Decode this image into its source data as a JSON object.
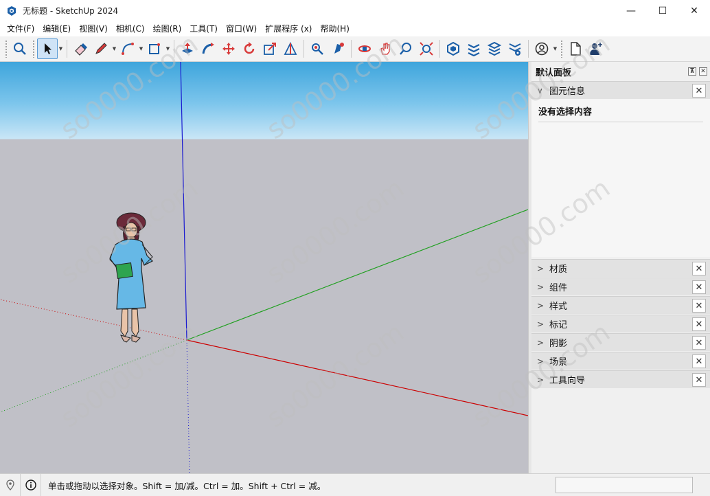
{
  "window": {
    "title": "无标题 - SketchUp 2024",
    "controls": [
      "—",
      "☐",
      "✕"
    ]
  },
  "menu": [
    "文件(F)",
    "编辑(E)",
    "视图(V)",
    "相机(C)",
    "绘图(R)",
    "工具(T)",
    "窗口(W)",
    "扩展程序 (x)",
    "帮助(H)"
  ],
  "toolbar": {
    "buttons": [
      "zoom-extents-icon",
      "select-icon",
      "eraser-icon",
      "pencil-icon",
      "arc-icon",
      "rectangle-icon",
      "push-pull-icon",
      "follow-me-icon",
      "move-icon",
      "rotate-icon",
      "scale-icon",
      "tape-measure-icon",
      "position-camera-icon",
      "walk-icon",
      "orbit-icon",
      "pan-icon",
      "zoom-icon",
      "zoom-window-icon",
      "3d-warehouse-icon",
      "extension-warehouse-icon",
      "layout-icon",
      "extension-manager-icon",
      "account-icon",
      "new-file-icon",
      "add-user-icon"
    ]
  },
  "panel": {
    "title": "默认面板",
    "entity_info": {
      "label": "图元信息",
      "status": "没有选择内容"
    },
    "trays": [
      "材质",
      "组件",
      "样式",
      "标记",
      "阴影",
      "场景",
      "工具向导"
    ]
  },
  "statusbar": {
    "hint": "单击或拖动以选择对象。Shift = 加/减。Ctrl = 加。Shift + Ctrl = 减。"
  },
  "watermark": "so0000.com",
  "colors": {
    "sky_top": "#3ea5dc",
    "ground": "#c0c0c7",
    "axis_red": "#cc0000",
    "axis_green": "#22a022",
    "axis_blue": "#1a1ad0",
    "selection_highlight": "#cfe3f6"
  }
}
